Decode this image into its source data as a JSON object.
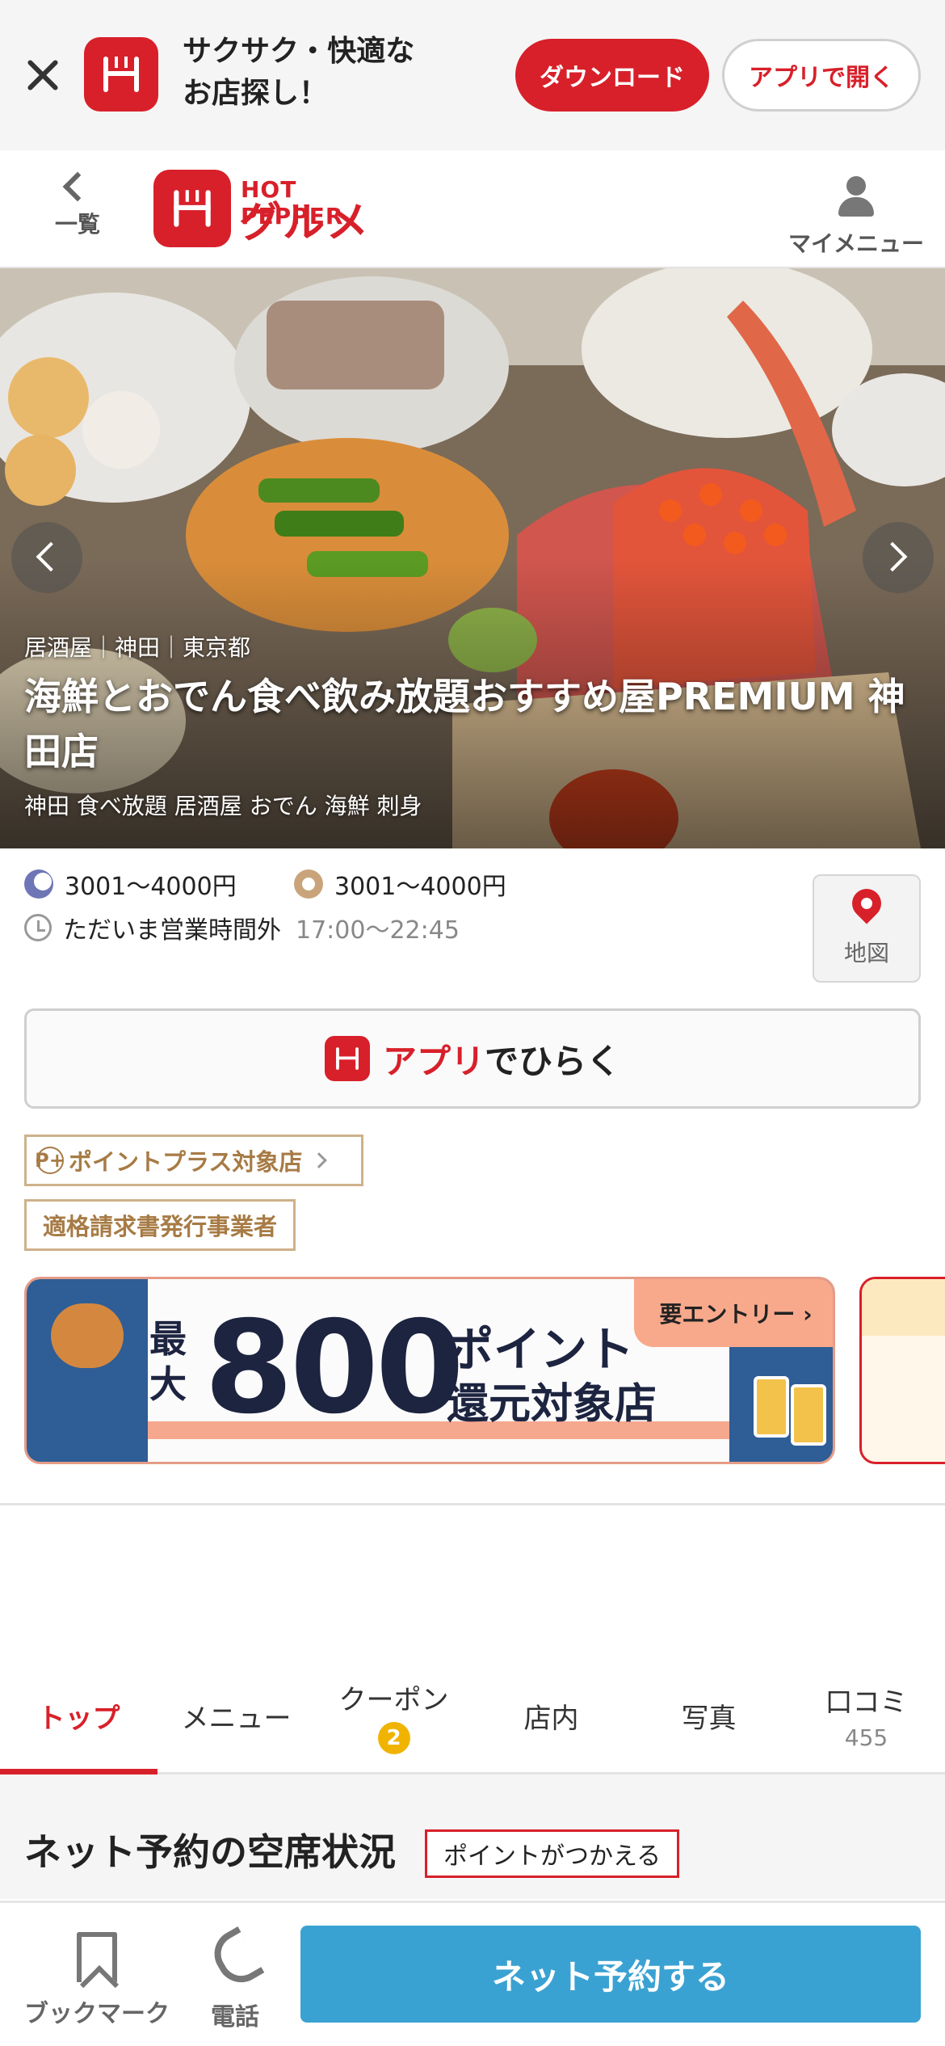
{
  "app_banner": {
    "message_line1": "サクサク・快適な",
    "message_line2": "お店探し！",
    "download_label": "ダウンロード",
    "open_app_label": "アプリで開く"
  },
  "header": {
    "back_label": "一覧",
    "logo_top": "HOT PEPPER",
    "logo_main": "グルメ",
    "mymenu_label": "マイメニュー"
  },
  "hero": {
    "category": "居酒屋｜神田｜東京都",
    "name": "海鮮とおでん食べ飲み放題おすすめ屋PREMIUM 神田店",
    "tags": "神田 食べ放題 居酒屋 おでん 海鮮 刺身"
  },
  "info": {
    "dinner_price": "3001～4000円",
    "lunch_price": "3001～4000円",
    "status": "ただいま営業時間外",
    "hours": "17:00～22:45",
    "map_label": "地図"
  },
  "open_app": {
    "red_part": "アプリ",
    "rest": "でひらく"
  },
  "badges": {
    "point_plus": "ポイントプラス対象店",
    "point_plus_mark": "P+",
    "invoice": "適格請求書発行事業者"
  },
  "promo": {
    "max": "最大",
    "number": "800",
    "line1": "ポイント",
    "line2": "還元対象店",
    "entry": "要エントリー ›"
  },
  "tabs": [
    {
      "label": "トップ"
    },
    {
      "label": "メニュー"
    },
    {
      "label": "クーポン",
      "count": "2"
    },
    {
      "label": "店内"
    },
    {
      "label": "写真"
    },
    {
      "label": "口コミ",
      "count": "455"
    }
  ],
  "section": {
    "title": "ネット予約の空席状況",
    "badge": "ポイントがつかえる"
  },
  "bottom_bar": {
    "bookmark_label": "ブックマーク",
    "phone_label": "電話",
    "reserve_label": "ネット予約する"
  },
  "colors": {
    "brand_red": "#d8202a",
    "reserve_blue": "#3aa2d2",
    "badge_gold": "#a77b45"
  }
}
